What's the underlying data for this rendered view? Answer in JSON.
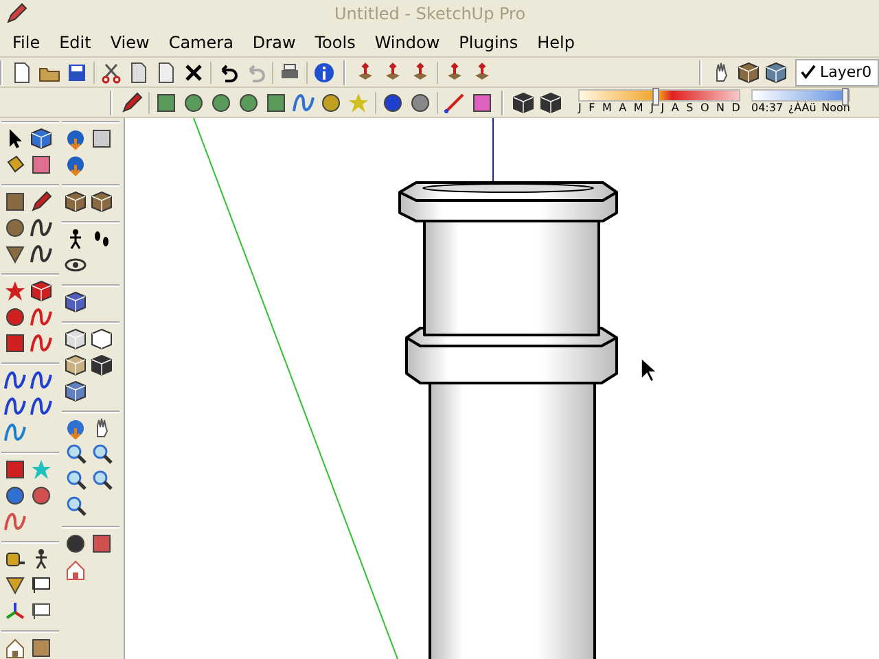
{
  "window": {
    "title": "Untitled - SketchUp Pro"
  },
  "menu": [
    "File",
    "Edit",
    "View",
    "Camera",
    "Draw",
    "Tools",
    "Window",
    "Plugins",
    "Help"
  ],
  "layers": {
    "checked": true,
    "current": "Layer0"
  },
  "shadow_date": {
    "level": 0.47,
    "months": [
      "J",
      "F",
      "M",
      "A",
      "M",
      "J",
      "J",
      "A",
      "S",
      "O",
      "N",
      "D"
    ]
  },
  "shadow_time": {
    "level": 0.96,
    "time": "04:37",
    "period": "¿ÀÀü",
    "noon": "Noon"
  }
}
